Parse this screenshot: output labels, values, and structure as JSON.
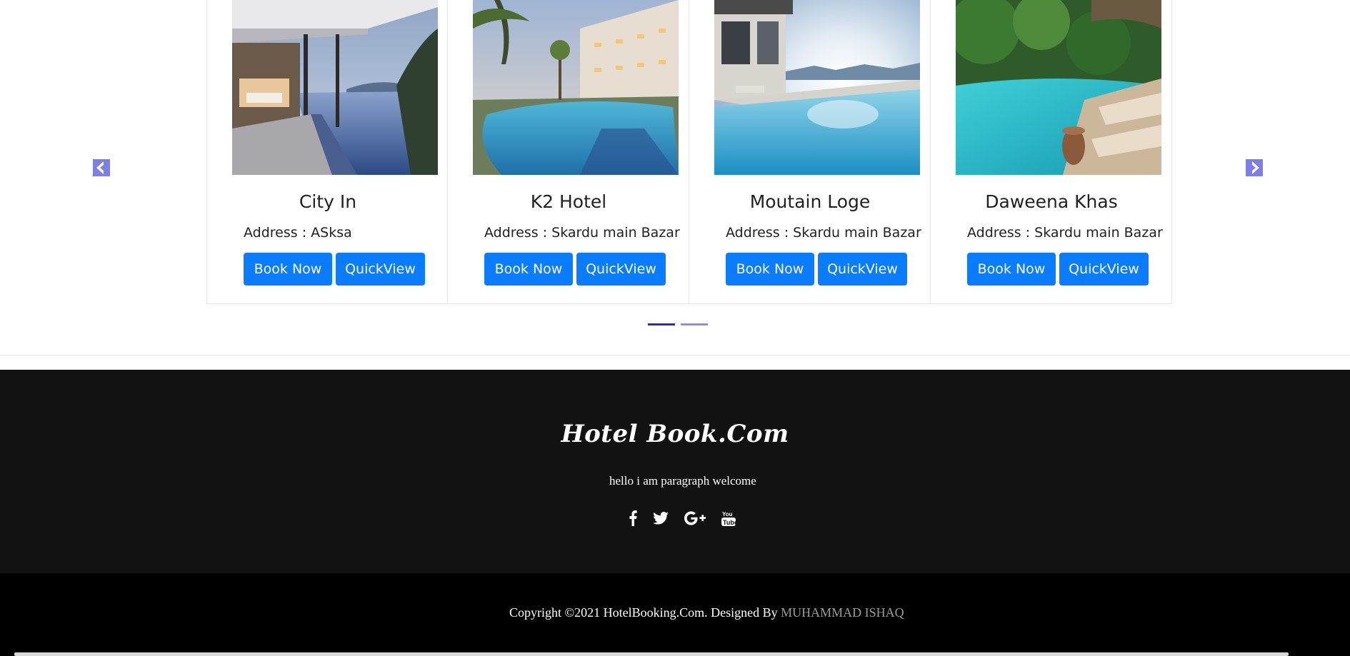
{
  "carousel": {
    "prev_icon": "chevron-left-icon",
    "next_icon": "chevron-right-icon",
    "accent_color": "#7b7fe6",
    "cards": [
      {
        "name": "City In",
        "address": "Address : ASksa",
        "book_label": "Book Now",
        "quickview_label": "QuickView",
        "photo": "villa-infinity-pool-photo"
      },
      {
        "name": "K2 Hotel",
        "address": "Address : Skardu main Bazar",
        "book_label": "Book Now",
        "quickview_label": "QuickView",
        "photo": "resort-pool-photo"
      },
      {
        "name": "Moutain Loge",
        "address": "Address : Skardu main Bazar",
        "book_label": "Book Now",
        "quickview_label": "QuickView",
        "photo": "sunset-pool-photo"
      },
      {
        "name": "Daweena Khas",
        "address": "Address : Skardu main Bazar",
        "book_label": "Book Now",
        "quickview_label": "QuickView",
        "photo": "tropical-pool-photo"
      }
    ],
    "button_color": "#0a7cff",
    "active_indicator": 1,
    "indicator_count": 2
  },
  "footer": {
    "brand": "Hotel Book.Com",
    "tagline": "hello i am paragraph welcome",
    "socials": [
      "facebook-icon",
      "twitter-icon",
      "google-plus-icon",
      "youtube-icon"
    ],
    "copyright_text": "Copyright ©2021 HotelBooking.Com. Designed By ",
    "designer": "MUHAMMAD ISHAQ"
  }
}
